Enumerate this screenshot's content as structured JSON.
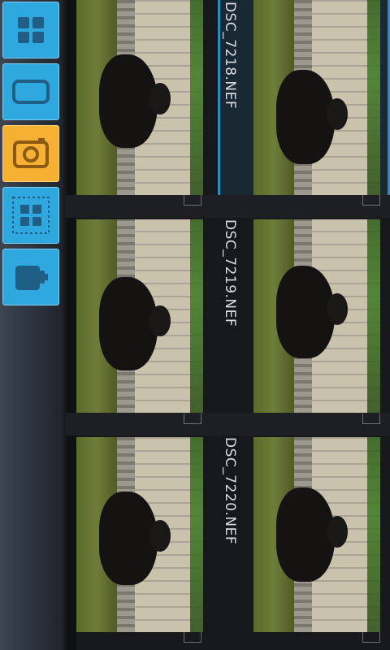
{
  "sidebar": {
    "buttons": [
      {
        "name": "grid-view-button",
        "icon": "grid-icon",
        "active": false
      },
      {
        "name": "device-view-button",
        "icon": "phone-icon",
        "active": false
      },
      {
        "name": "camera-view-button",
        "icon": "camera-icon",
        "active": true
      },
      {
        "name": "select-all-button",
        "icon": "select-grid-icon",
        "active": false
      },
      {
        "name": "delete-button",
        "icon": "trash-icon",
        "active": false
      }
    ]
  },
  "files": [
    {
      "name": "DSC_7218.NEF",
      "selected": true
    },
    {
      "name": "DSC_7219.NEF",
      "selected": false
    },
    {
      "name": "DSC_7220.NEF",
      "selected": false
    }
  ],
  "colors": {
    "accent_blue": "#2ea8de",
    "accent_orange": "#f6b135",
    "selection": "#2a8fb8"
  }
}
